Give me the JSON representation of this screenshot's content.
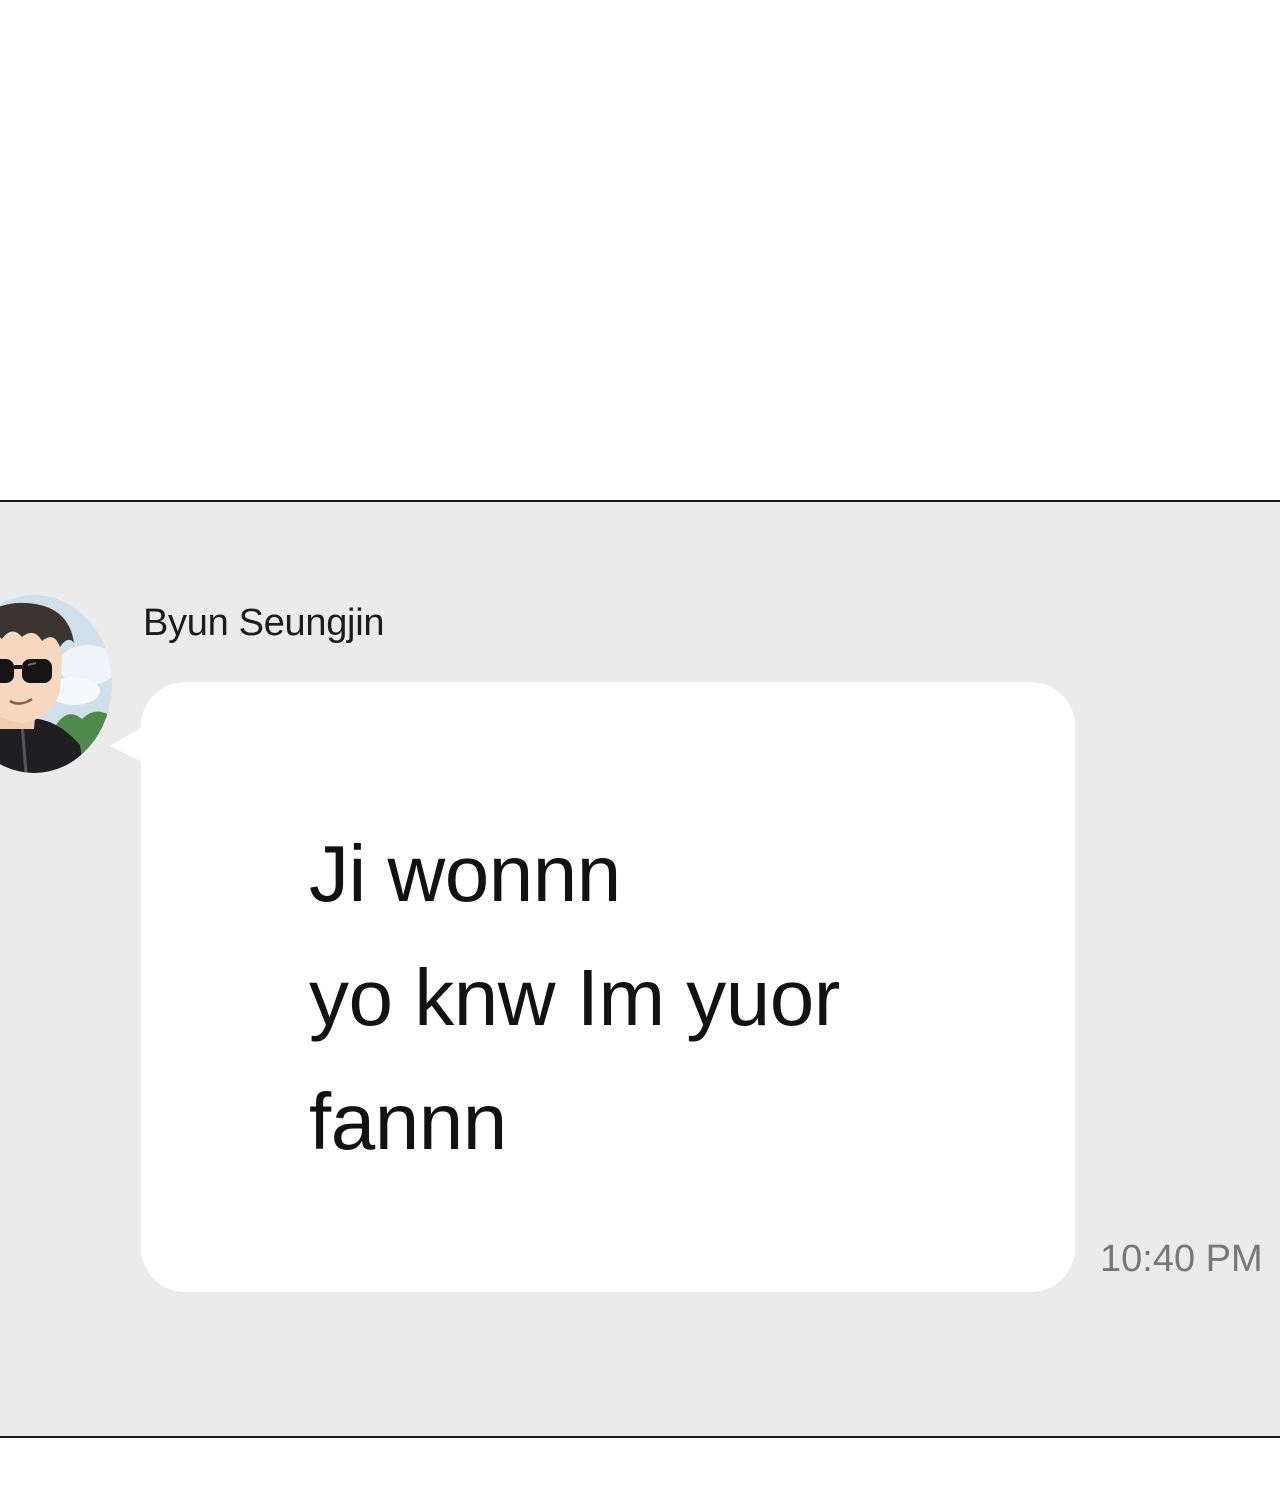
{
  "chat": {
    "sender_name": "Byun Seungjin",
    "avatar_icon": "profile-avatar-sunglasses",
    "message": "Ji wonnn\nyo knw Im yuor\nfannn",
    "timestamp": "10:40 PM"
  },
  "colors": {
    "panel_background": "#ebebeb",
    "bubble_background": "#ffffff",
    "text": "#121212",
    "timestamp": "#777777",
    "divider": "#1a1a1a"
  }
}
